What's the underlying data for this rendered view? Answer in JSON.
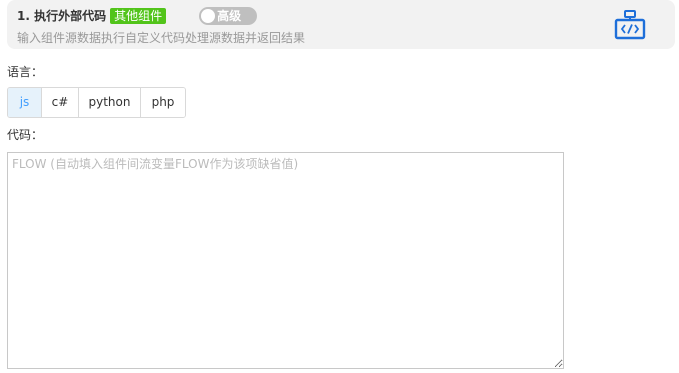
{
  "header": {
    "step_title": "1. 执行外部代码",
    "category_badge": "其他组件",
    "toggle_label": "高级",
    "description": "输入组件源数据执行自定义代码处理源数据并返回结果",
    "icon": "code-icon"
  },
  "language": {
    "label": "语言：",
    "options": [
      "js",
      "c#",
      "python",
      "php"
    ],
    "selected": "js"
  },
  "code": {
    "label": "代码：",
    "placeholder": "FLOW (自动填入组件间流变量FLOW作为该项缺省值)",
    "value": ""
  },
  "colors": {
    "accent": "#409eff",
    "badge": "#52c41a",
    "icon": "#1e6fd9"
  }
}
